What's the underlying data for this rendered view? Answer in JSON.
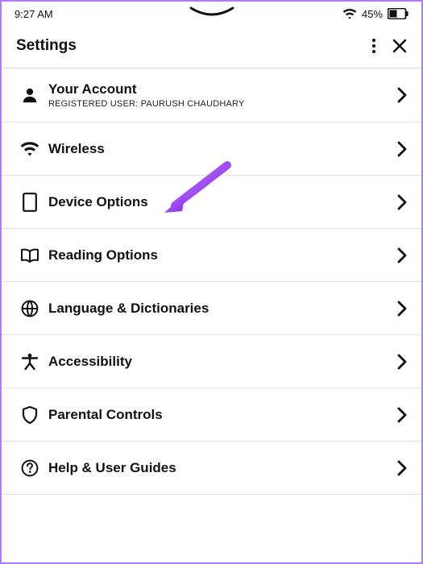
{
  "statusbar": {
    "time": "9:27 AM",
    "battery_pct": "45%"
  },
  "header": {
    "title": "Settings"
  },
  "rows": {
    "account": {
      "label": "Your Account",
      "sublabel": "REGISTERED USER: PAURUSH CHAUDHARY"
    },
    "wireless": {
      "label": "Wireless"
    },
    "device": {
      "label": "Device Options"
    },
    "reading": {
      "label": "Reading Options"
    },
    "lang": {
      "label": "Language & Dictionaries"
    },
    "accessibility": {
      "label": "Accessibility"
    },
    "parental": {
      "label": "Parental Controls"
    },
    "help": {
      "label": "Help & User Guides"
    }
  },
  "annotation": {
    "arrow_target": "device-options",
    "arrow_color": "#9a3ff0"
  }
}
